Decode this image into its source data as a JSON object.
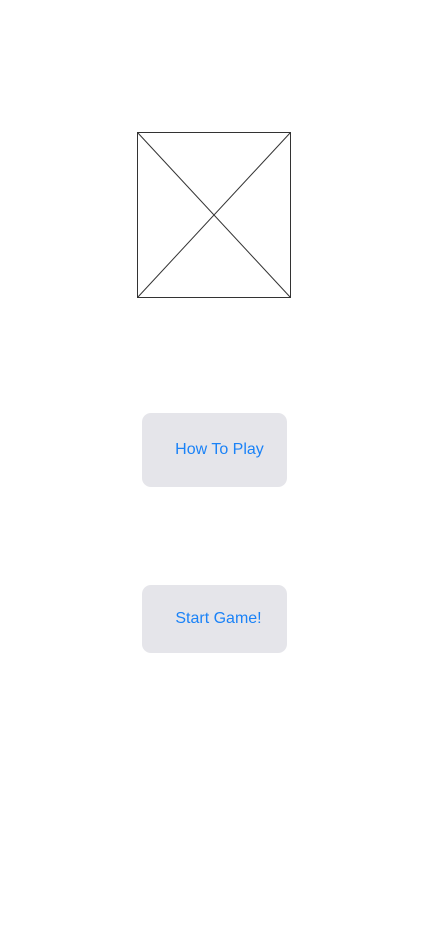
{
  "main": {
    "logo_icon": "image-placeholder-icon",
    "buttons": {
      "how_to_play_label": "How To Play",
      "start_game_label": "Start Game!"
    }
  },
  "colors": {
    "background": "#ffffff",
    "button_background": "#e5e5ea",
    "button_text": "#1a82f7",
    "placeholder_stroke": "#333333"
  }
}
